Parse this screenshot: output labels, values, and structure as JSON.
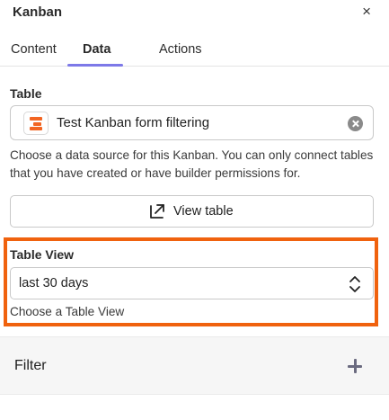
{
  "header": {
    "title": "Kanban",
    "close_glyph": "×"
  },
  "tabs": [
    {
      "label": "Content",
      "active": false
    },
    {
      "label": "Data",
      "active": true
    },
    {
      "label": "Actions",
      "active": false
    }
  ],
  "table_section": {
    "label": "Table",
    "selected_table": "Test Kanban form filtering",
    "help_text": "Choose a data source for this Kanban. You can only connect tables that you have created or have builder permissions for.",
    "view_button_label": "View table",
    "icon": "external-link-icon"
  },
  "table_view_section": {
    "label": "Table View",
    "selected_value": "last 30 days",
    "help_text": "Choose a Table View",
    "highlight_color": "#f0620e"
  },
  "filter_section": {
    "label": "Filter",
    "icon": "plus-icon"
  },
  "colors": {
    "accent": "#7d79e8",
    "brand": "#f26522"
  }
}
